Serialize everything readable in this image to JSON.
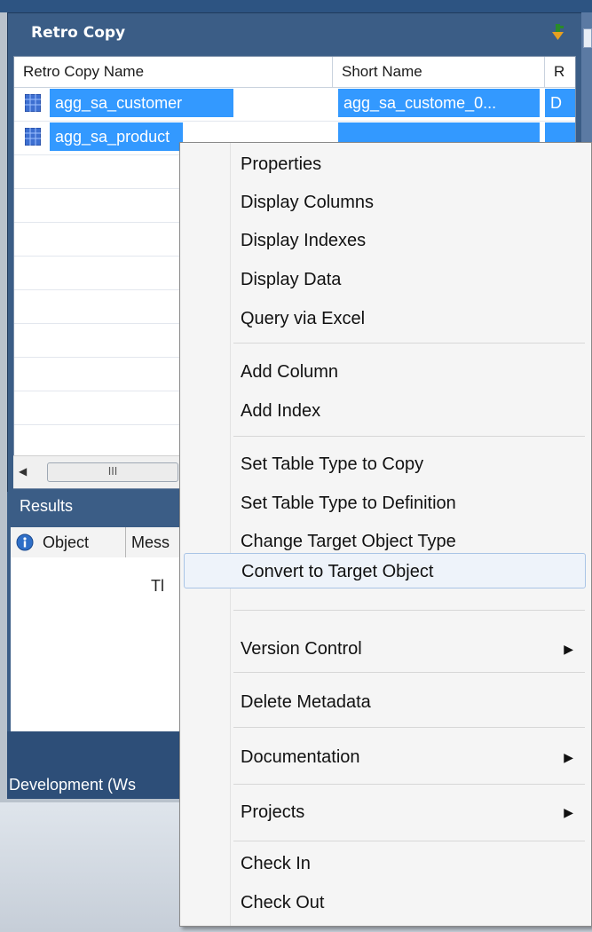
{
  "retro_copy": {
    "title": "Retro Copy",
    "columns": [
      "Retro Copy Name",
      "Short Name",
      "R"
    ],
    "rows": [
      {
        "name": "agg_sa_customer",
        "short": "agg_sa_custome_0...",
        "r": "D"
      },
      {
        "name": "agg_sa_product",
        "short": "",
        "r": ""
      }
    ],
    "scrollbar_thumb": "III"
  },
  "results": {
    "title": "Results",
    "columns": [
      "Object",
      "Mess"
    ],
    "message": "Tl"
  },
  "status_bar": {
    "text": "Development (Ws"
  },
  "context_menu": {
    "items": [
      {
        "label": "Properties"
      },
      {
        "label": "Display Columns"
      },
      {
        "label": "Display Indexes"
      },
      {
        "label": "Display Data"
      },
      {
        "label": "Query via Excel"
      },
      {
        "label": "Add Column"
      },
      {
        "label": "Add Index"
      },
      {
        "label": "Set Table Type to Copy"
      },
      {
        "label": "Set Table Type to Definition"
      },
      {
        "label": "Change Target Object Type"
      },
      {
        "label": "Convert to Target Object"
      },
      {
        "label": "Version Control"
      },
      {
        "label": "Delete Metadata"
      },
      {
        "label": "Documentation"
      },
      {
        "label": "Projects"
      },
      {
        "label": "Check In"
      },
      {
        "label": "Check Out"
      }
    ],
    "submenu_arrow": "▶"
  },
  "colors": {
    "panel": "#3b5d86",
    "selection": "#3399ff",
    "menu_hover_border": "#a9c4e6"
  }
}
